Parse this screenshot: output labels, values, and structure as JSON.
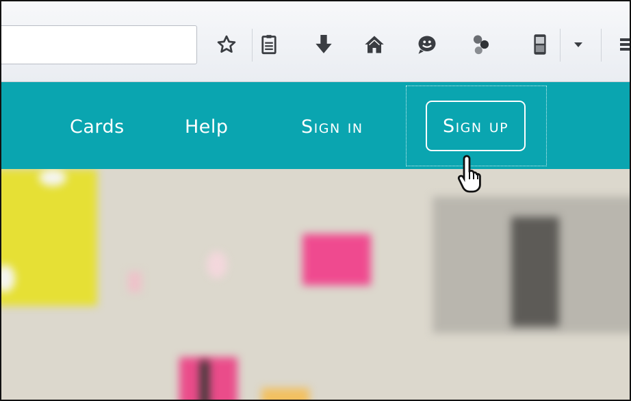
{
  "toolbar": {
    "url_value": "",
    "icons": [
      "star-icon",
      "reading-list-icon",
      "download-icon",
      "home-icon",
      "chat-icon",
      "extension-icon",
      "phone-icon",
      "dropdown-icon",
      "menu-icon"
    ]
  },
  "nav": {
    "items": [
      {
        "label": "Cards"
      },
      {
        "label": "Help"
      },
      {
        "label": "Sign in"
      },
      {
        "label": "Sign up"
      }
    ]
  },
  "colors": {
    "navbar": "#0aa5b0",
    "toolbar": "#eef0f4",
    "hero": "#dcd8cd"
  }
}
